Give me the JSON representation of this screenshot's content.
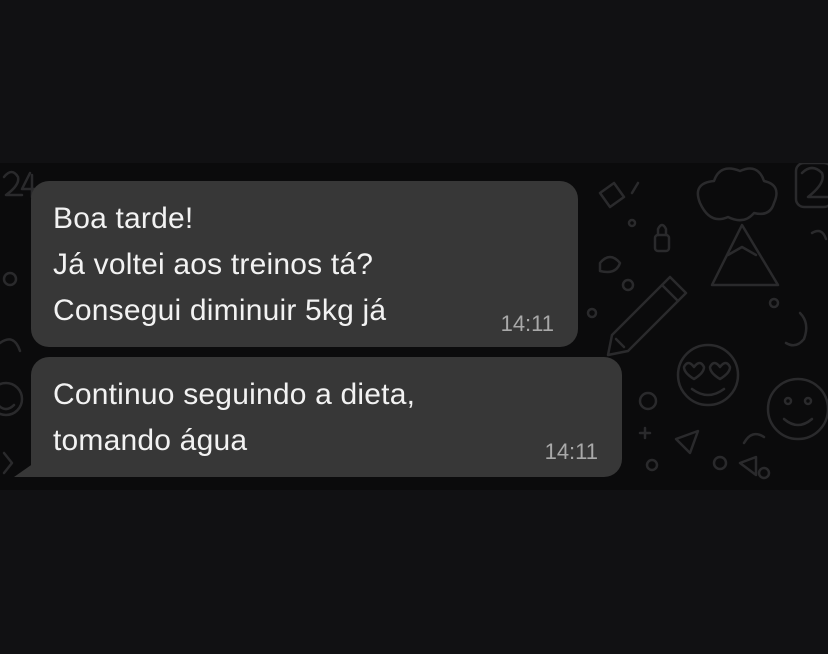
{
  "chat": {
    "messages": [
      {
        "lines": [
          "Boa tarde!",
          "Já voltei aos treinos tá?",
          "Consegui diminuir 5kg já"
        ],
        "time": "14:11"
      },
      {
        "lines": [
          "Continuo seguindo a dieta,",
          "tomando água"
        ],
        "time": "14:11"
      }
    ]
  },
  "wallpaper": {
    "icons": [
      "number-24-icon",
      "number-2-icon",
      "pencil-icon",
      "mountain-icon",
      "cloud-icon",
      "smiley-icon",
      "heart-eyes-icon",
      "lock-icon",
      "arrow-icon",
      "circle-icon"
    ]
  },
  "colors": {
    "background": "#111113",
    "chat_background": "#0b0b0c",
    "bubble": "#373737",
    "text": "#f2f2f2",
    "timestamp": "#a9a9a9"
  }
}
